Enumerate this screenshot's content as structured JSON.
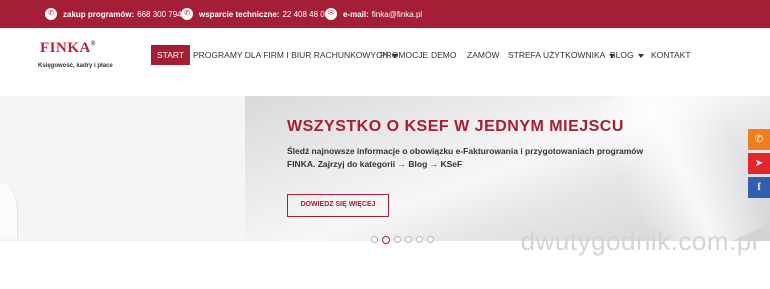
{
  "topbar": {
    "contacts": [
      {
        "icon": "phone-icon",
        "label": "zakup programów:",
        "value": "668 300 794"
      },
      {
        "icon": "phone-icon",
        "label": "wsparcie techniczne:",
        "value": "22 408 48 00"
      },
      {
        "icon": "mail-icon",
        "label": "e-mail:",
        "value": "finka@finka.pl"
      }
    ]
  },
  "logo": {
    "word": "FINKA",
    "reg": "®",
    "tagline": "Księgowość, kadry i płace"
  },
  "nav": {
    "items": [
      {
        "label": "START",
        "active": true
      },
      {
        "label": "PROGRAMY DLA FIRM I BIUR RACHUNKOWYCH",
        "dropdown": true
      },
      {
        "label": "PROMOCJE"
      },
      {
        "label": "DEMO"
      },
      {
        "label": "ZAMÓW"
      },
      {
        "label": "STREFA UŻYTKOWNIKA",
        "dropdown": true
      },
      {
        "label": "BLOG",
        "dropdown": true
      },
      {
        "label": "KONTAKT"
      }
    ]
  },
  "hero": {
    "title": "WSZYSTKO O KSEF W JEDNYM MIEJSCU",
    "text": "Śledź najnowsze informacje o obowiązku e-Fakturowania i przygotowaniach programów FINKA. Zajrzyj do kategorii → Blog → KSeF",
    "button": "DOWIEDZ SIĘ WIĘCEJ"
  },
  "slider": {
    "count": 6,
    "active_index": 1
  },
  "side_icons": [
    "phone-icon",
    "tag-icon",
    "facebook-icon"
  ],
  "watermark": "dwutygodnik.com.pl",
  "colors": {
    "brand": "#a41e35",
    "orange": "#f07d1f",
    "red": "#e3262e",
    "facebook": "#2f5fae"
  }
}
